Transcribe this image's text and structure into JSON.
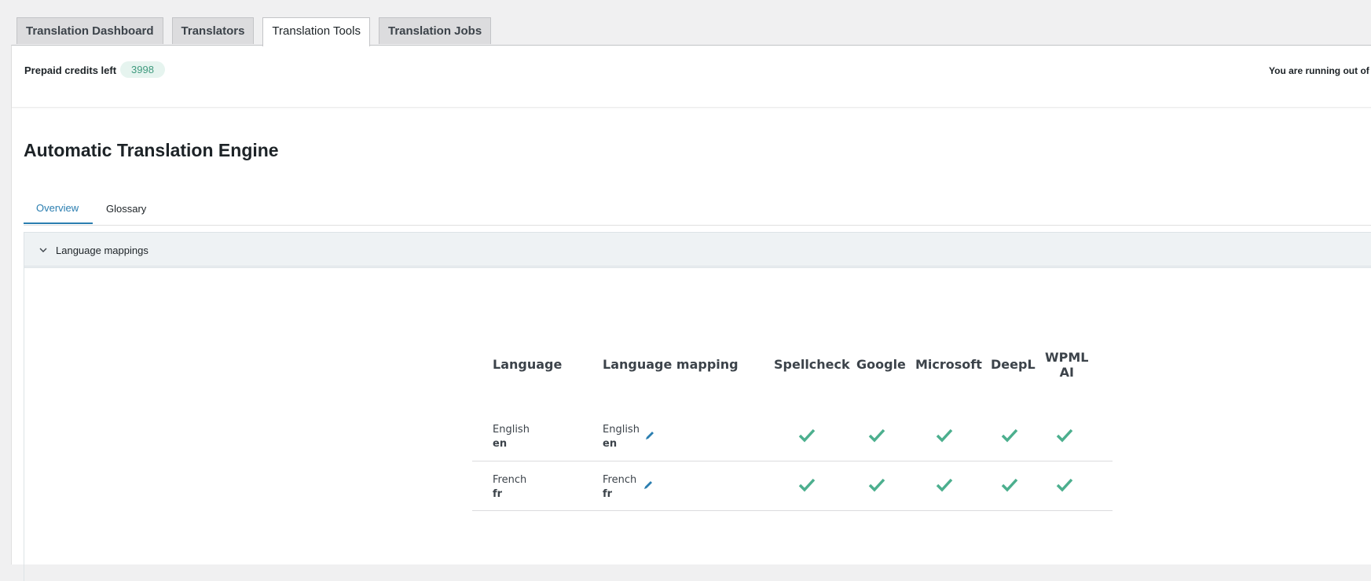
{
  "nav_tabs": [
    {
      "label": "Translation Dashboard",
      "active": false
    },
    {
      "label": "Translators",
      "active": false
    },
    {
      "label": "Translation Tools",
      "active": true
    },
    {
      "label": "Translation Jobs",
      "active": false
    }
  ],
  "credits": {
    "label": "Prepaid credits left",
    "value": "3998",
    "warning": "You are running out of pr"
  },
  "engine": {
    "title": "Automatic Translation Engine",
    "tabs": [
      "Overview",
      "Glossary"
    ],
    "active_tab": "Overview"
  },
  "section": {
    "title": "Language mappings",
    "expanded": true
  },
  "table": {
    "headers": {
      "language": "Language",
      "mapping": "Language mapping",
      "spellcheck": "Spellcheck",
      "google": "Google",
      "microsoft": "Microsoft",
      "deepl": "DeepL",
      "wpml_ai_line1": "WPML",
      "wpml_ai_line2": "AI"
    },
    "rows": [
      {
        "language": "English",
        "code": "en",
        "mapping_language": "English",
        "mapping_code": "en",
        "spellcheck": true,
        "google": true,
        "microsoft": true,
        "deepl": true,
        "wpml_ai": true
      },
      {
        "language": "French",
        "code": "fr",
        "mapping_language": "French",
        "mapping_code": "fr",
        "spellcheck": true,
        "google": true,
        "microsoft": true,
        "deepl": true,
        "wpml_ai": true
      }
    ]
  },
  "colors": {
    "accent": "#2b7eb0",
    "check": "#4caf8e",
    "badge_bg": "#e6f4ef",
    "badge_text": "#3f9a7e"
  },
  "icons": [
    "chevron-down-icon",
    "pencil-icon",
    "checkmark-icon"
  ]
}
